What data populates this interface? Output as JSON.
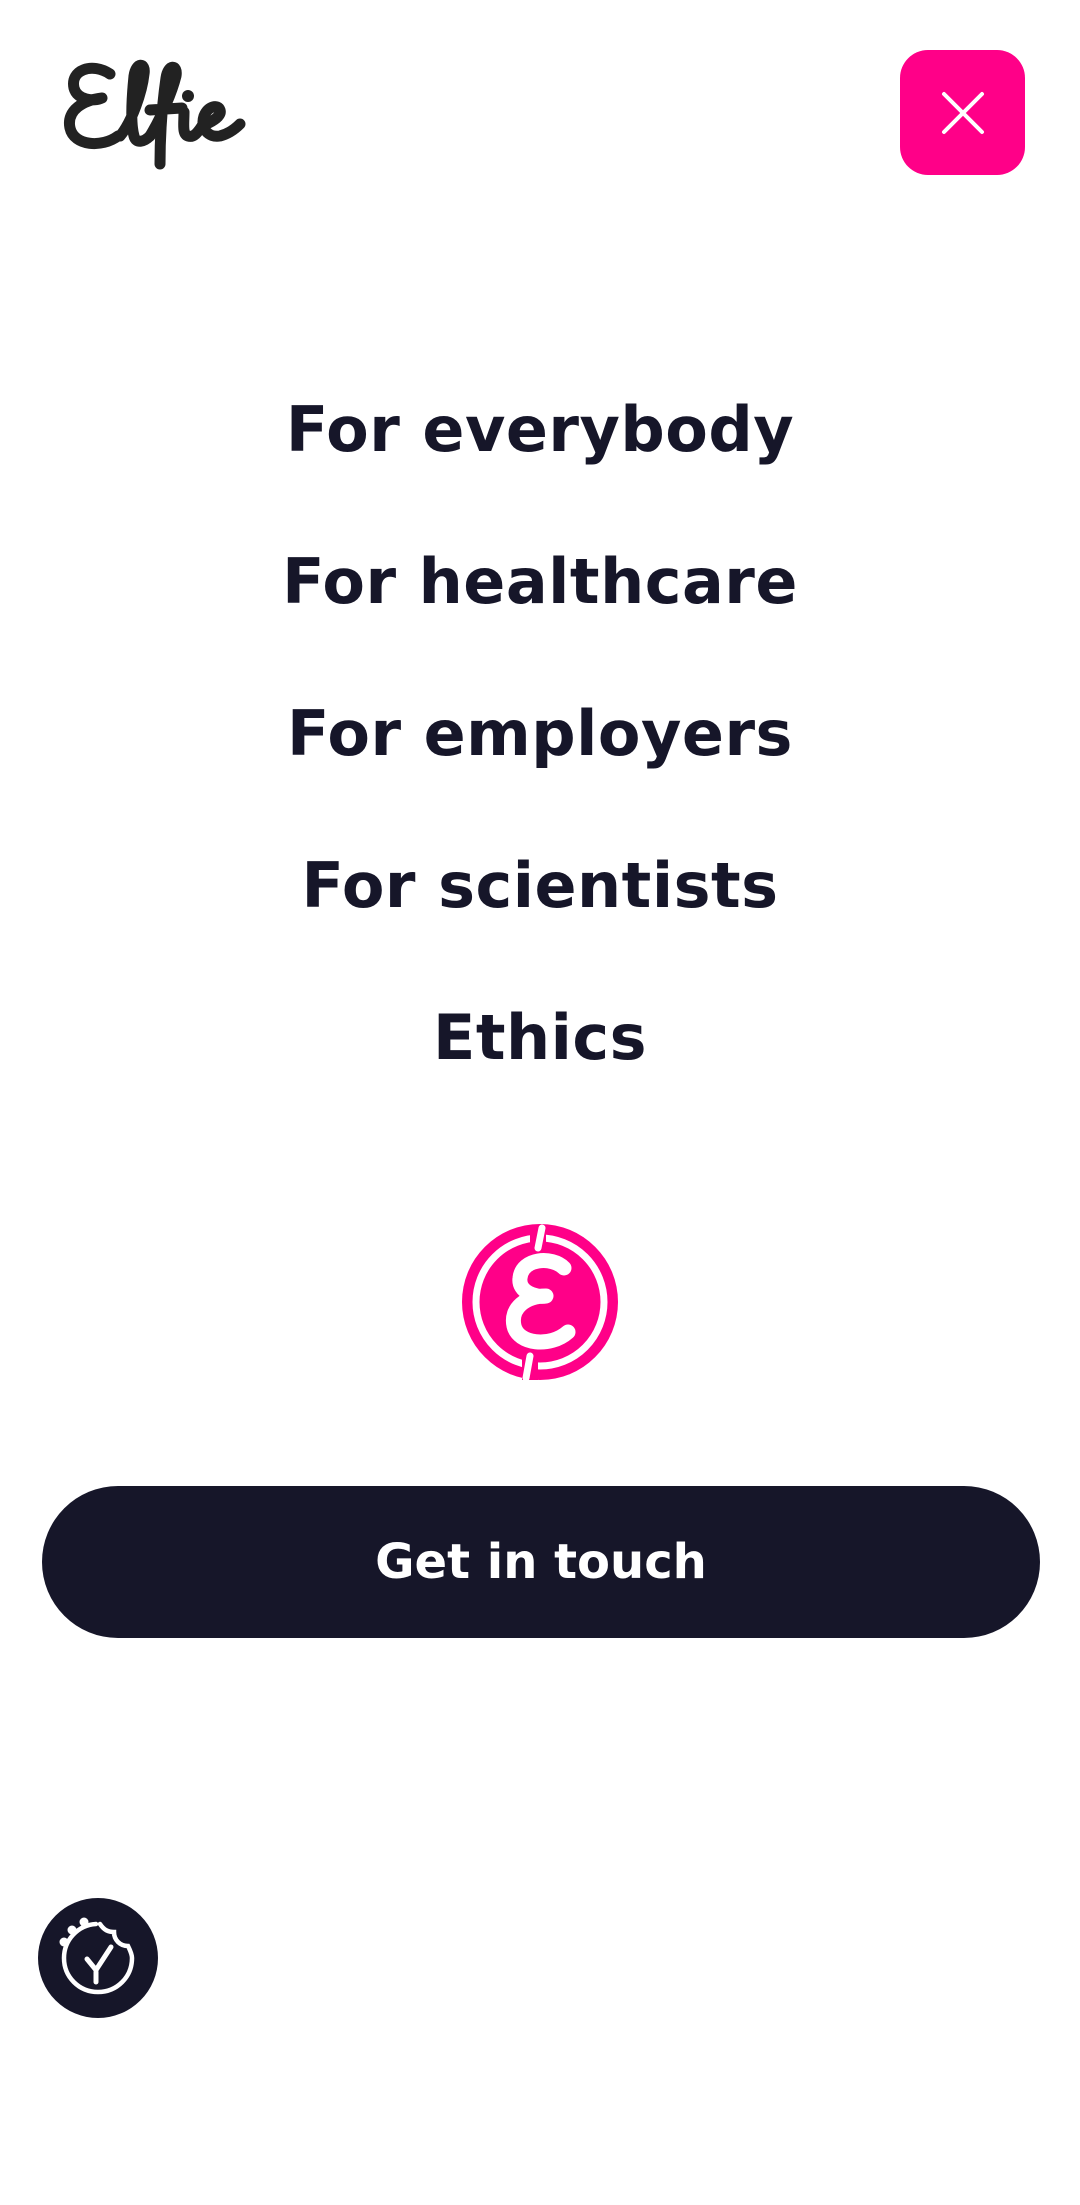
{
  "header": {
    "logo_text": "Elfie",
    "logo_icon": "elfie-wordmark",
    "close_icon": "close-icon"
  },
  "nav": {
    "items": [
      {
        "label": "For everybody"
      },
      {
        "label": "For healthcare"
      },
      {
        "label": "For employers"
      },
      {
        "label": "For scientists"
      },
      {
        "label": "Ethics"
      }
    ]
  },
  "brand_mark": {
    "icon": "elfie-e-badge-icon"
  },
  "cta": {
    "label": "Get in touch"
  },
  "cookie": {
    "icon": "cookie-consent-icon"
  },
  "colors": {
    "accent": "#ff0088",
    "dark": "#161629",
    "background": "#ffffff"
  }
}
